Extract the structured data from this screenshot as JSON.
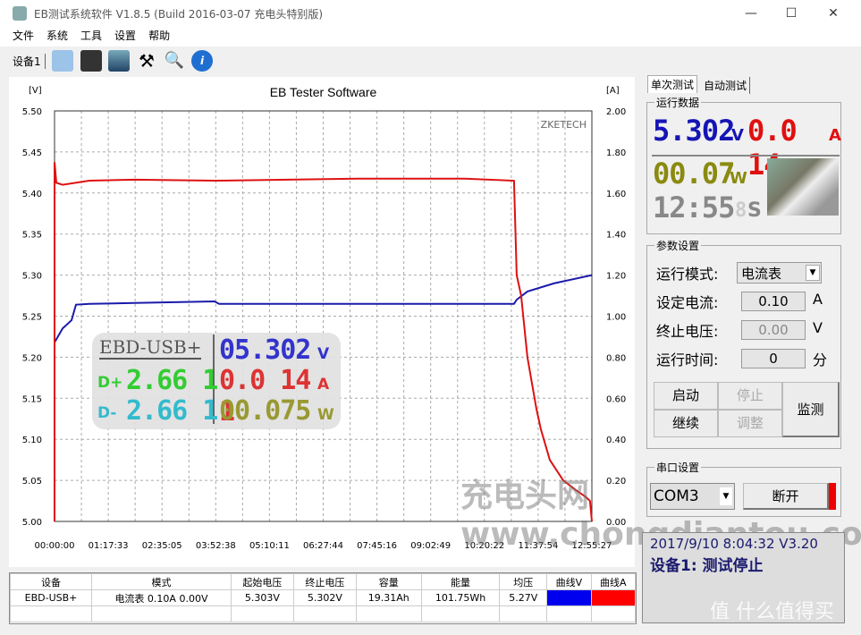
{
  "window": {
    "title": "EB测试系统软件 V1.8.5 (Build 2016-03-07 充电头特别版)",
    "minimize": "—",
    "maximize": "☐",
    "close": "✕"
  },
  "menu": [
    "文件",
    "系统",
    "工具",
    "设置",
    "帮助"
  ],
  "toolbar": {
    "device_tab": "设备1",
    "icons": [
      "folder-open-icon",
      "save-icon",
      "image-icon",
      "tools-icon",
      "search-icon",
      "info-icon"
    ]
  },
  "chart_data": {
    "type": "line",
    "title": "EB Tester Software",
    "watermark": "ZKETECH",
    "ylabel_left": "[V]",
    "ylabel_right": "[A]",
    "ylim_left": [
      5.0,
      5.5
    ],
    "ylim_right": [
      0,
      2.0
    ],
    "yticks_left": [
      "5.50",
      "5.45",
      "5.40",
      "5.35",
      "5.30",
      "5.25",
      "5.20",
      "5.15",
      "5.10",
      "5.05",
      "5.00"
    ],
    "yticks_right": [
      "2.00",
      "1.80",
      "1.60",
      "1.40",
      "1.20",
      "1.00",
      "0.80",
      "0.60",
      "0.40",
      "0.20",
      "0.00"
    ],
    "xticks": [
      "00:00:00",
      "01:17:33",
      "02:35:05",
      "03:52:38",
      "05:10:11",
      "06:27:44",
      "07:45:16",
      "09:02:49",
      "10:20:22",
      "11:37:54",
      "12:55:27"
    ],
    "grid": true,
    "series": [
      {
        "axis": "left",
        "color": "#1a1aaa",
        "points": [
          [
            "00:00:00",
            5.218
          ],
          [
            "00:11:37",
            5.235
          ],
          [
            "00:24:31",
            5.245
          ],
          [
            "00:30:58",
            5.264
          ],
          [
            "00:50:19",
            5.265
          ],
          [
            "01:54:49",
            5.266
          ],
          [
            "03:50:55",
            5.268
          ],
          [
            "03:57:22",
            5.265
          ],
          [
            "07:17:19",
            5.265
          ],
          [
            "11:03:04",
            5.265
          ],
          [
            "11:06:56",
            5.27
          ],
          [
            "11:22:25",
            5.28
          ],
          [
            "12:01:07",
            5.29
          ],
          [
            "12:55:27",
            5.3
          ]
        ]
      },
      {
        "axis": "right",
        "color": "#dd1111",
        "points": [
          [
            "00:00:00",
            0.0
          ],
          [
            "00:00:01",
            1.75
          ],
          [
            "00:02:35",
            1.65
          ],
          [
            "00:11:37",
            1.64
          ],
          [
            "00:50:19",
            1.66
          ],
          [
            "01:54:49",
            1.665
          ],
          [
            "03:50:55",
            1.66
          ],
          [
            "07:17:19",
            1.67
          ],
          [
            "09:52:07",
            1.67
          ],
          [
            "11:03:04",
            1.66
          ],
          [
            "11:06:56",
            1.2
          ],
          [
            "11:13:23",
            1.1
          ],
          [
            "11:22:25",
            0.8
          ],
          [
            "11:35:19",
            0.55
          ],
          [
            "11:41:46",
            0.45
          ],
          [
            "11:54:40",
            0.3
          ],
          [
            "12:14:01",
            0.2
          ],
          [
            "12:33:22",
            0.15
          ],
          [
            "12:46:16",
            0.12
          ],
          [
            "12:52:43",
            0.1
          ],
          [
            "12:55:27",
            0.0
          ]
        ]
      }
    ]
  },
  "overlay": {
    "name": "EBD-USB+",
    "dplus_label": "D+",
    "dplus": "2.66 1",
    "dminus_label": "D-",
    "dminus": "2.66 1",
    "voltage": "05.302",
    "voltage_unit": "V",
    "current": "0.0 14 1",
    "current_unit": "A",
    "power": "00.075",
    "power_unit": "W"
  },
  "table": {
    "headers": [
      "设备",
      "模式",
      "起始电压",
      "终止电压",
      "容量",
      "能量",
      "均压",
      "曲线V",
      "曲线A"
    ],
    "rows": [
      [
        "EBD-USB+",
        "电流表  0.10A  0.00V",
        "5.303V",
        "5.302V",
        "19.31Ah",
        "101.75Wh",
        "5.27V",
        "",
        ""
      ]
    ],
    "curve_colors": [
      "#0000ee",
      "#ff0000"
    ]
  },
  "right": {
    "tabs": [
      "单次测试",
      "自动测试"
    ],
    "run_group": "运行数据",
    "voltage": "5.302",
    "voltage_unit": "V",
    "current": "0.0 14",
    "current_unit": "A",
    "power": "00.07",
    "power_unit": "W",
    "time": "12:55",
    "time_sec": "8",
    "time_unit": "S",
    "param_group": "参数设置",
    "mode_label": "运行模式:",
    "mode_value": "电流表",
    "current_label": "设定电流:",
    "current_value": "0.10",
    "current_unit2": "A",
    "stopv_label": "终止电压:",
    "stopv_value": "0.00",
    "stopv_unit": "V",
    "time_label": "运行时间:",
    "time_value": "0",
    "time_unit2": "分",
    "buttons": {
      "start": "启动",
      "stop": "停止",
      "continue": "继续",
      "adjust": "调整",
      "monitor": "监测"
    },
    "serial_group": "串口设置",
    "com": "COM3",
    "disconnect": "断开"
  },
  "status": {
    "line1": "2017/9/10 8:04:32  V3.20",
    "line2": "设备1: 测试停止"
  },
  "watermarks": [
    "充电头网 www.chongdiantou.com",
    "值 什么值得买"
  ]
}
